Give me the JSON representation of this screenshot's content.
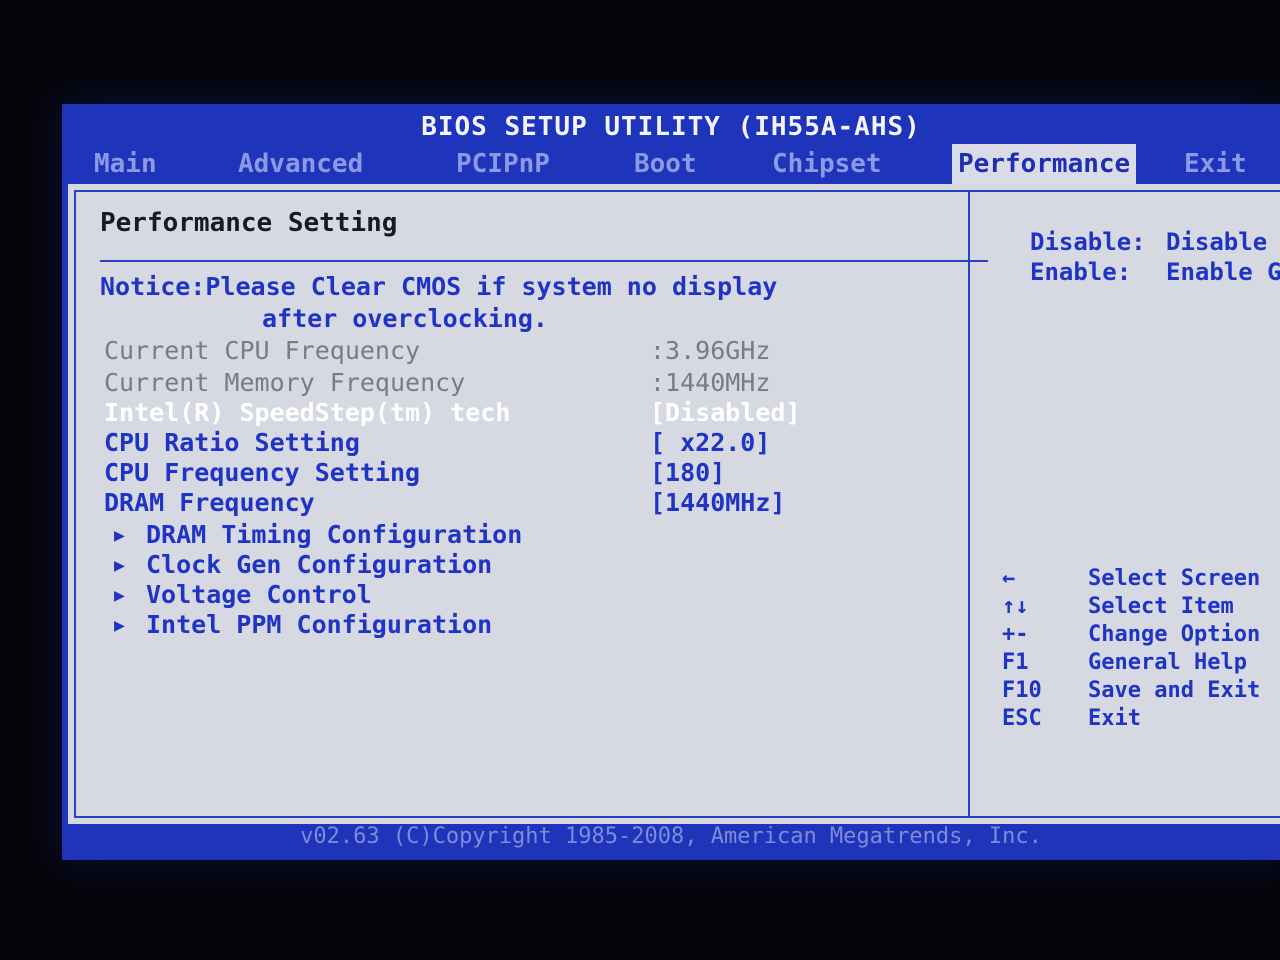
{
  "title": "BIOS SETUP UTILITY (IH55A-AHS)",
  "tabs": [
    "Main",
    "Advanced",
    "PCIPnP",
    "Boot",
    "Chipset",
    "Performance",
    "Exit"
  ],
  "active_tab": "Performance",
  "section_title": "Performance Setting",
  "notice_line1": "Notice:Please Clear CMOS if system no display",
  "notice_line2": "after overclocking.",
  "info_rows": [
    {
      "label": "Current CPU Frequency",
      "value": ":3.96GHz"
    },
    {
      "label": "Current Memory Frequency",
      "value": ":1440MHz"
    }
  ],
  "settings": [
    {
      "label": "Intel(R) SpeedStep(tm) tech",
      "value": "[Disabled]"
    },
    {
      "label": "CPU Ratio Setting",
      "value": "[ x22.0]"
    },
    {
      "label": "CPU Frequency Setting",
      "value": "[180]"
    },
    {
      "label": "DRAM Frequency",
      "value": "[1440MHz]"
    }
  ],
  "submenus": [
    "DRAM Timing Configuration",
    "Clock Gen Configuration",
    "Voltage Control",
    "Intel PPM Configuration"
  ],
  "submenu_arrow_glyph": "▶",
  "help": [
    {
      "key": "Disable:",
      "value": "Disable"
    },
    {
      "key": "Enable:",
      "value": "Enable G"
    }
  ],
  "keys": [
    {
      "key": "←",
      "desc": "Select Screen"
    },
    {
      "key": "↑↓",
      "desc": "Select Item"
    },
    {
      "key": "+-",
      "desc": "Change Option"
    },
    {
      "key": "F1",
      "desc": "General Help"
    },
    {
      "key": "F10",
      "desc": "Save and Exit"
    },
    {
      "key": "ESC",
      "desc": "Exit"
    }
  ],
  "footer": "v02.63 (C)Copyright 1985-2008, American Megatrends, Inc.",
  "colors": {
    "frame": "#1d34bb",
    "panel": "#d6d8e2",
    "text_blue": "#1f34c4",
    "text_gray": "#7b7b84",
    "highlight": "#ffffff"
  }
}
